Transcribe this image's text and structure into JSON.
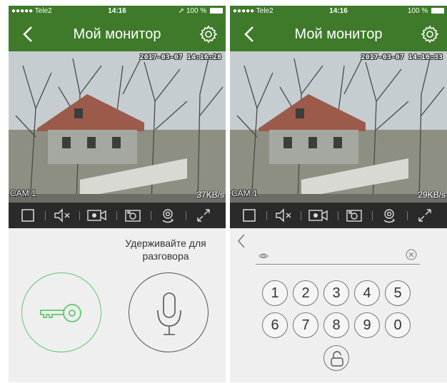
{
  "left_screen": {
    "status": {
      "carrier": "●●●●● Tele2",
      "time": "14:16",
      "battery": "100 %"
    },
    "nav": {
      "title": "Мой монитор"
    },
    "video": {
      "timestamp": "2017-03-07 14:16:28",
      "camera": "CAM 1",
      "bitrate": "37KB/s"
    },
    "toolbar": [
      "stop-icon",
      "mute-icon",
      "record-icon",
      "snapshot-icon",
      "switch-camera-icon",
      "fullscreen-icon"
    ],
    "talk": {
      "hint_line1": "Удерживайте для",
      "hint_line2": "разговора"
    }
  },
  "right_screen": {
    "status": {
      "carrier": "●●●●● Tele2",
      "time": "14:16",
      "battery": "100 %"
    },
    "nav": {
      "title": "Мой монитор"
    },
    "video": {
      "timestamp": "2017-03-07 14:16:33",
      "camera": "CAM 1",
      "bitrate": "29KB/s"
    },
    "toolbar": [
      "stop-icon",
      "mute-icon",
      "record-icon",
      "snapshot-icon",
      "switch-camera-icon",
      "fullscreen-icon"
    ],
    "pin": {
      "value": "",
      "placeholder": ""
    },
    "keypad": {
      "row1": [
        "1",
        "2",
        "3",
        "4",
        "5"
      ],
      "row2": [
        "6",
        "7",
        "8",
        "9",
        "0"
      ]
    }
  },
  "colors": {
    "header": "#3e7a2a",
    "toolbar": "#2a2a2a",
    "key_ring": "#61c96a",
    "background": "#efefef"
  }
}
